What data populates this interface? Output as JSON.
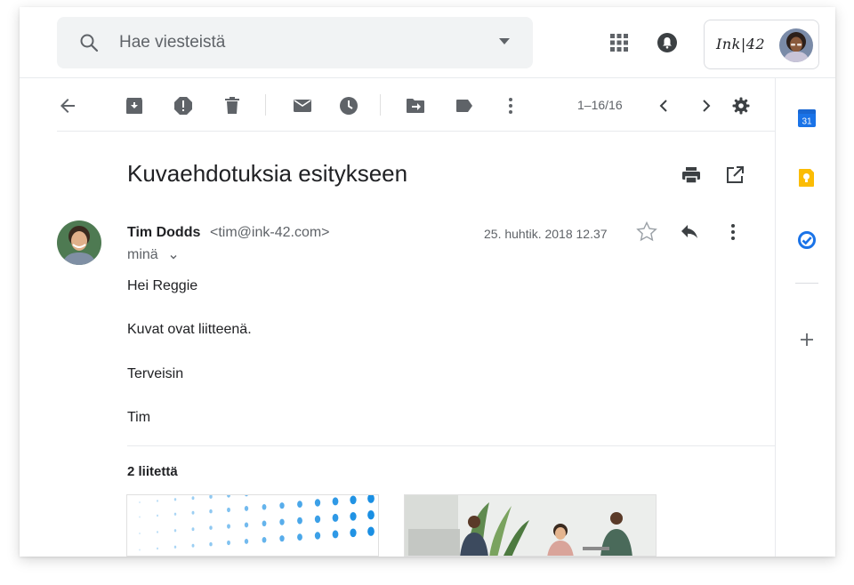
{
  "search": {
    "placeholder": "Hae viesteistä"
  },
  "account": {
    "logo_text": "Ink|42"
  },
  "toolbar": {
    "actions": [
      "back-icon",
      "archive-icon",
      "report-spam-icon",
      "delete-icon",
      "mark-unread-icon",
      "snooze-icon",
      "move-to-icon",
      "label-icon",
      "more-vert-icon"
    ],
    "pager": "1–16/16"
  },
  "sidepanel": {
    "apps": [
      "calendar-icon",
      "keep-icon",
      "tasks-icon",
      "add-icon"
    ],
    "calendar_day": "31"
  },
  "message": {
    "subject": "Kuvaehdotuksia esitykseen",
    "sender_name": "Tim Dodds",
    "sender_email": "<tim@ink-42.com>",
    "recipient": "minä",
    "date": "25. huhtik. 2018 12.37",
    "body": [
      "Hei Reggie",
      "Kuvat ovat liitteenä.",
      "Terveisin",
      "Tim"
    ]
  },
  "attachments": {
    "title": "2 liitettä",
    "count": 2
  },
  "colors": {
    "accent_blue": "#1a73e8",
    "icon_gray": "#5f6368",
    "keep_yellow": "#fbbc04",
    "search_bg": "#f1f3f4"
  }
}
